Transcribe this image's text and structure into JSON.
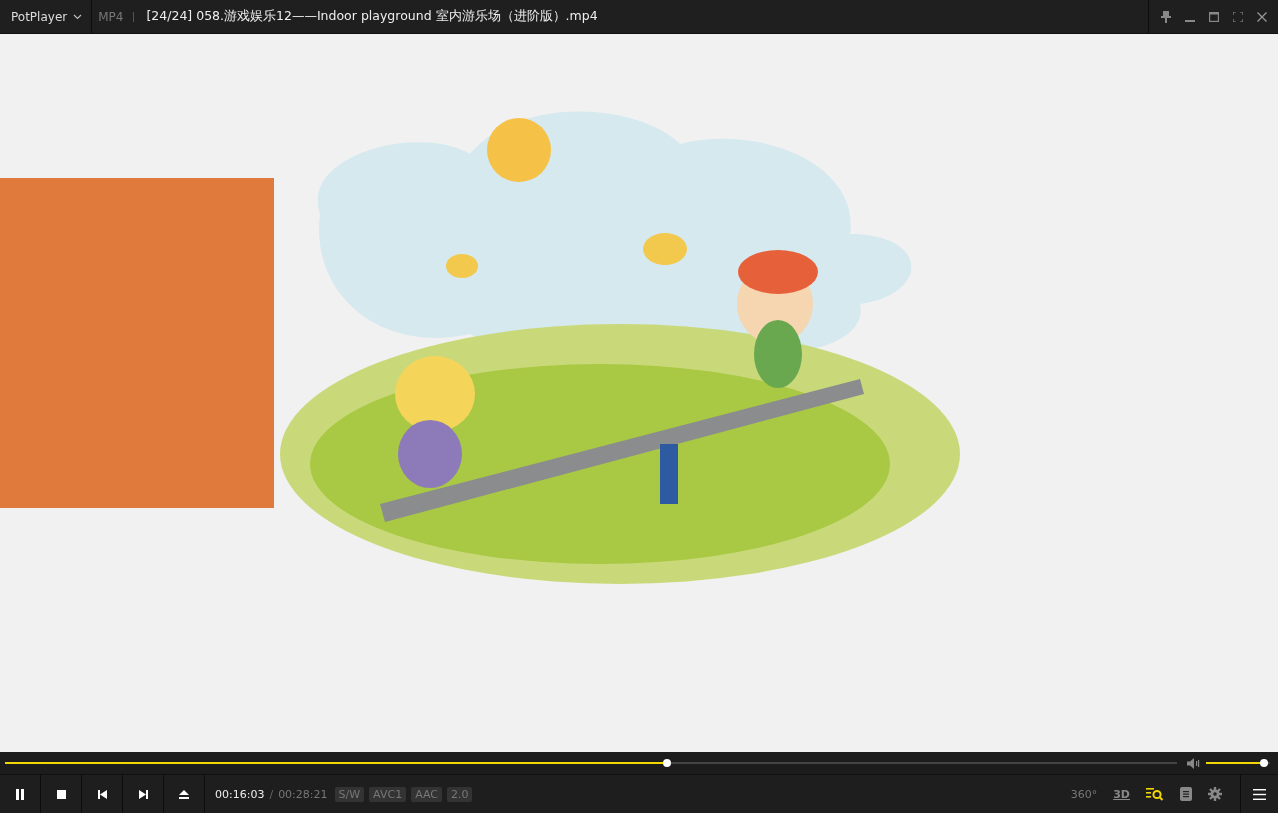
{
  "title_bar": {
    "app_menu": "PotPlayer",
    "format": "MP4",
    "title": "[24/24] 058.游戏娱乐12——Indoor playground 室内游乐场（进阶版）.mp4"
  },
  "seek_bar": {
    "level": 0.565
  },
  "volume": {
    "level": 0.97
  },
  "controls": {
    "current_time": "00:16:03",
    "separator": "/",
    "total_time": "00:28:21",
    "badges": [
      "S/W",
      "AVC1",
      "AAC",
      "2.0"
    ],
    "right_labels": [
      "360°",
      "3D"
    ]
  }
}
